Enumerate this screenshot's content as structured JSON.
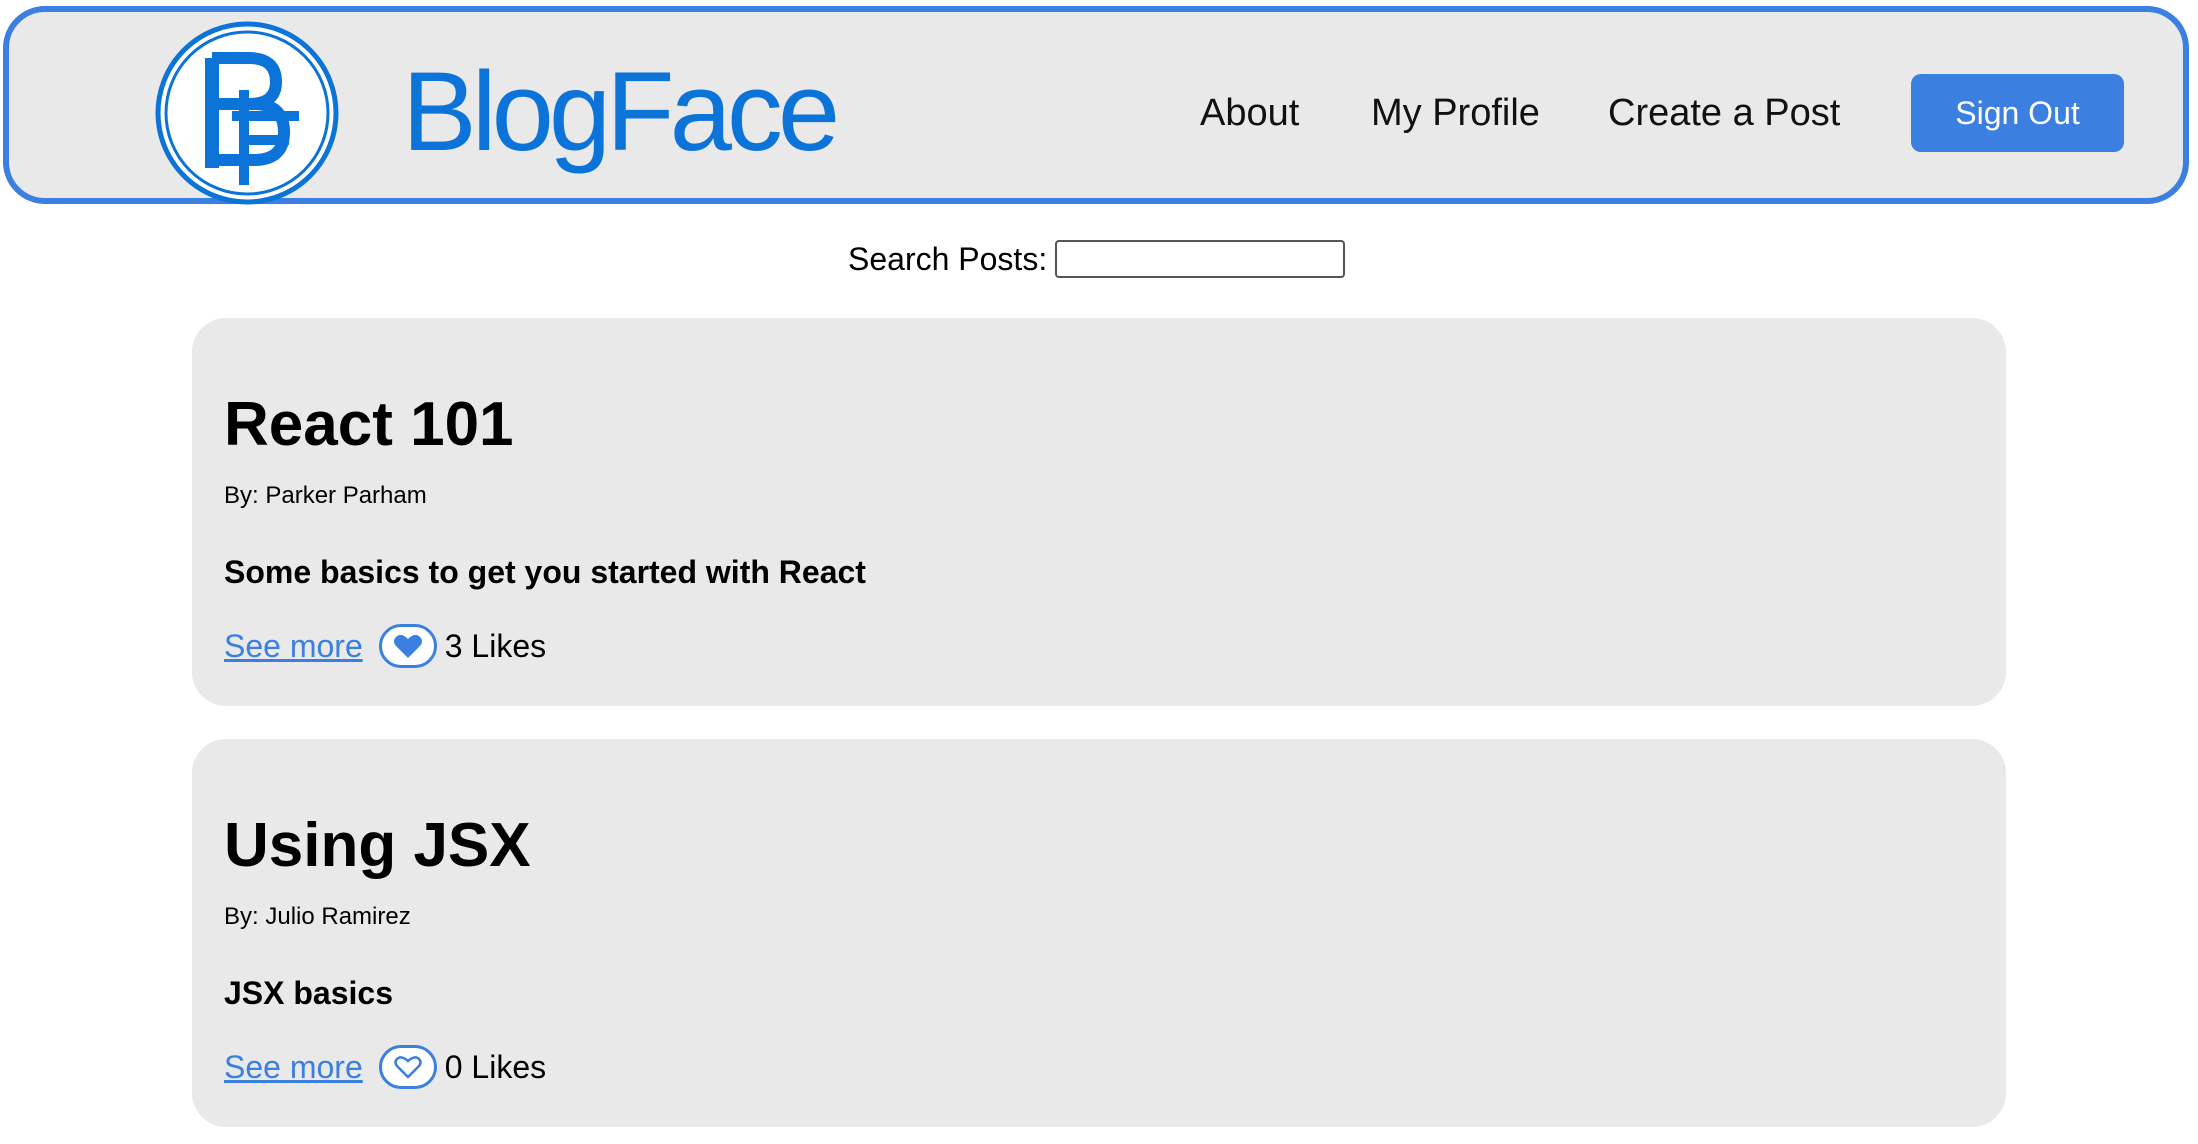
{
  "brand": {
    "name": "BlogFace",
    "logo_icon": "bf-monogram-logo"
  },
  "nav": {
    "about": "About",
    "my_profile": "My Profile",
    "create_post": "Create a Post",
    "sign_out": "Sign Out"
  },
  "search": {
    "label": "Search Posts:",
    "value": "",
    "placeholder": ""
  },
  "colors": {
    "accent": "#3b7fe0",
    "brand": "#0c73d9",
    "card_bg": "#e9e9ea"
  },
  "posts": [
    {
      "title": "React 101",
      "author": "By: Parker Parham",
      "description": "Some basics to get you started with React",
      "see_more": "See more",
      "likes": "3 Likes",
      "liked": true,
      "like_icon": "heart-filled-icon"
    },
    {
      "title": "Using JSX",
      "author": "By: Julio Ramirez",
      "description": "JSX basics",
      "see_more": "See more",
      "likes": "0 Likes",
      "liked": false,
      "like_icon": "heart-outline-icon"
    }
  ]
}
